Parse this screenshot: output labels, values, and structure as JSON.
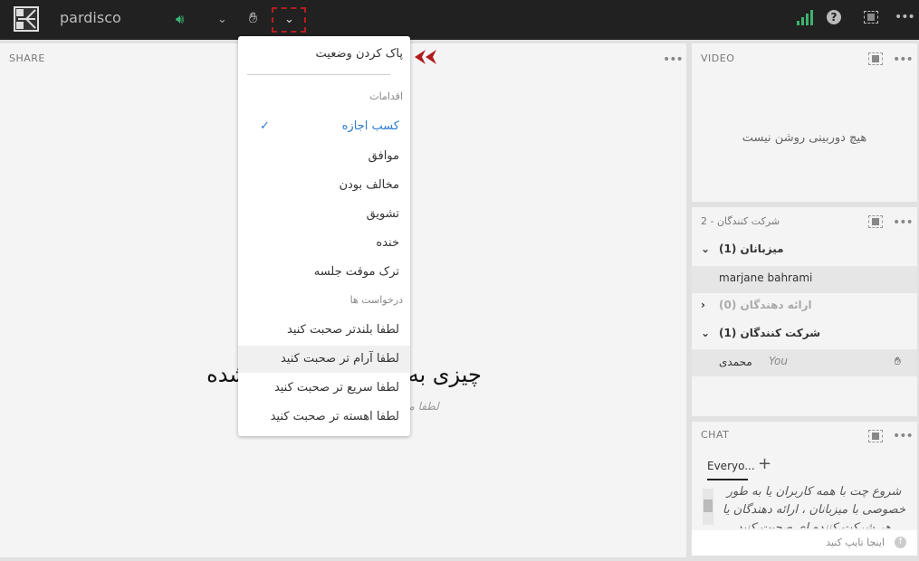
{
  "topbar": {
    "brand": "pardisco",
    "icons": [
      "logo-icon",
      "speaker-icon",
      "chevron-down-icon",
      "raise-hand-icon",
      "chevron-down-icon",
      "signal-icon",
      "help-icon",
      "fullscreen-icon",
      "more-icon"
    ]
  },
  "share": {
    "title": "SHARE",
    "main_text": "چیزی به اشتراک گذاشته نشده",
    "sub_text": "لطفا منتظر بمانید تا ارائه دهنده شروع کند"
  },
  "menu": {
    "clear": "پاک کردن وضعیت",
    "actions_header": "اقدامات",
    "actions": [
      "کسب اجازه",
      "موافق",
      "مخالف بودن",
      "تشویق",
      "خنده",
      "ترک موقت جلسه"
    ],
    "requests_header": "درخواست ها",
    "requests": [
      "لطفا بلندتر صحبت کنید",
      "لطفا آرام تر صحبت کنید",
      "لطفا سریع تر صحبت کنید",
      "لطفا اهسته تر صحبت کنید"
    ],
    "accent": "#2b7bd1"
  },
  "video": {
    "title": "VIDEO",
    "empty": "هیچ دوربینی روشن نیست"
  },
  "participants": {
    "title": "شرکت کنندگان - 2",
    "groups": [
      {
        "label": "میزبانان (1)",
        "members": [
          "marjane bahrami"
        ]
      },
      {
        "label": "ارائه دهندگان (0)",
        "members": []
      },
      {
        "label": "شرکت کنندگان (1)",
        "members": [
          "محمدی"
        ]
      }
    ],
    "you": "You"
  },
  "chat": {
    "title": "CHAT",
    "tab": "Everyo...",
    "add": "+",
    "welcome": "شروع چت با همه کاربران یا به طور خصوصی با میزبانان ، ارائه دهندگان یا هر شرکت کننده ای صحبت کنید",
    "placeholder": "اینجا تایپ کنید"
  }
}
